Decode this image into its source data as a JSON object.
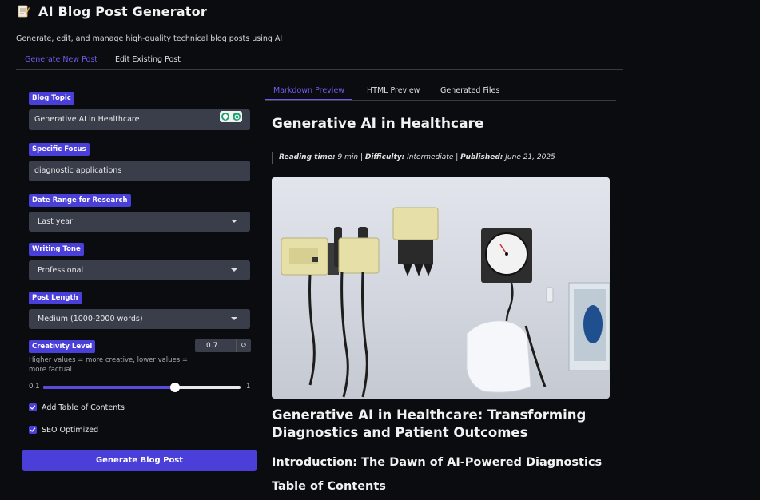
{
  "app": {
    "title": "AI Blog Post Generator",
    "title_icon": "memo-icon",
    "subtitle": "Generate, edit, and manage high-quality technical blog posts using AI"
  },
  "main_tabs": [
    {
      "label": "Generate New Post",
      "active": true
    },
    {
      "label": "Edit Existing Post",
      "active": false
    }
  ],
  "form": {
    "blog_topic": {
      "label": "Blog Topic",
      "value": "Generative AI in Healthcare"
    },
    "specific_focus": {
      "label": "Specific Focus",
      "value": "diagnostic applications"
    },
    "date_range": {
      "label": "Date Range for Research",
      "value": "Last year"
    },
    "writing_tone": {
      "label": "Writing Tone",
      "value": "Professional"
    },
    "post_length": {
      "label": "Post Length",
      "value": "Medium (1000-2000 words)"
    },
    "creativity": {
      "label": "Creativity Level",
      "value": "0.7",
      "help": "Higher values = more creative, lower values = more factual",
      "min": "0.1",
      "max": "1",
      "fraction": 0.67
    },
    "add_toc": {
      "label": "Add Table of Contents",
      "checked": true
    },
    "seo": {
      "label": "SEO Optimized",
      "checked": true
    },
    "generate_button": "Generate Blog Post"
  },
  "preview_tabs": [
    {
      "label": "Markdown Preview",
      "active": true
    },
    {
      "label": "HTML Preview",
      "active": false
    },
    {
      "label": "Generated Files",
      "active": false
    }
  ],
  "preview": {
    "title": "Generative AI in Healthcare",
    "meta": {
      "reading_label": "Reading time:",
      "reading_value": "9 min",
      "difficulty_label": "Difficulty:",
      "difficulty_value": "Intermediate",
      "published_label": "Published:",
      "published_value": "June 21, 2025",
      "sep": "|"
    },
    "heading": "Generative AI in Healthcare: Transforming Diagnostics and Patient Outcomes",
    "intro_heading": "Introduction: The Dawn of AI-Powered Diagnostics",
    "toc_heading": "Table of Contents"
  },
  "colors": {
    "accent": "#4a3fd8",
    "tab_active": "#6f5cf0",
    "background": "#0b0c10",
    "input_bg": "#3a3e4b"
  }
}
